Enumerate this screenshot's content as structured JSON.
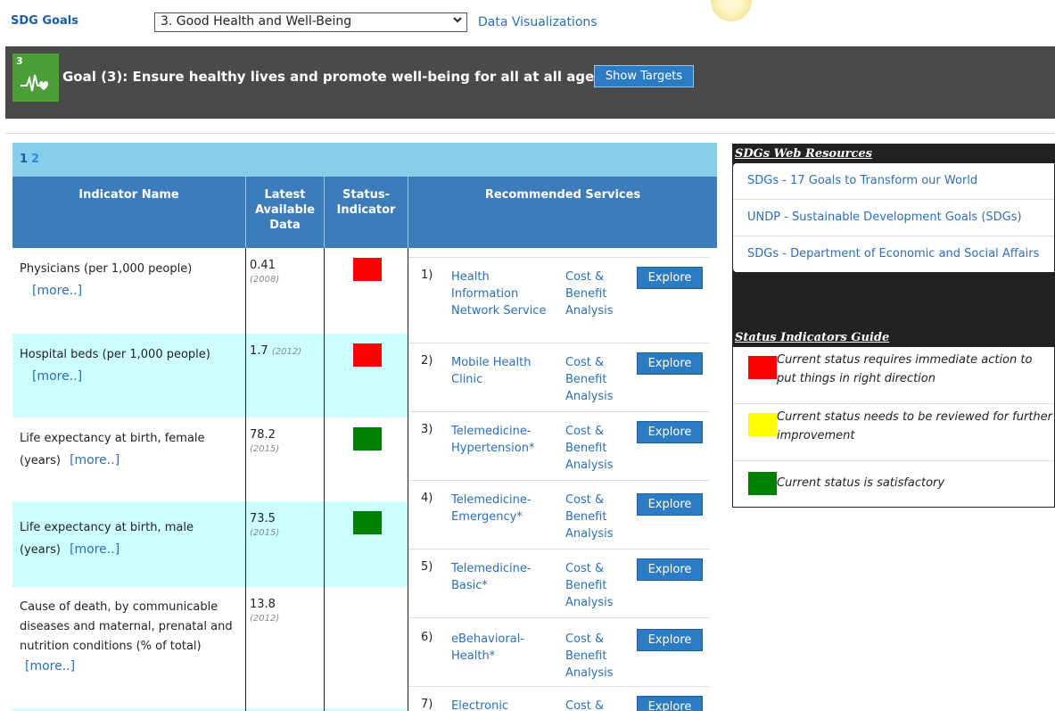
{
  "header": {
    "sdg_label": "SDG Goals",
    "selected_goal": "3. Good Health and Well-Being",
    "data_vis_link": "Data Visualizations"
  },
  "banner": {
    "icon_number": "3",
    "title": "Goal (3): Ensure healthy lives and promote well-being for all at all ages",
    "show_targets": "Show Targets",
    "icon_color": "#4c9f38"
  },
  "pager": [
    "1",
    "2"
  ],
  "table_headers": {
    "name": "Indicator Name",
    "latest": "Latest Available Data",
    "status": "Status-Indicator",
    "services": "Recommended Services"
  },
  "indicators": [
    {
      "name": "Physicians (per 1,000 people)",
      "value": "0.41",
      "year": "(2008)",
      "status": "red",
      "more": "[more..]"
    },
    {
      "name": "Hospital beds (per 1,000 people)",
      "value": "1.7",
      "year": "(2012)",
      "status": "red",
      "more": "[more..]"
    },
    {
      "name": "Life expectancy at birth, female (years)",
      "value": "78.2",
      "year": "(2015)",
      "status": "green",
      "more": "[more..]"
    },
    {
      "name": "Life expectancy at birth, male (years)",
      "value": "73.5",
      "year": "(2015)",
      "status": "green",
      "more": "[more..]"
    },
    {
      "name": "Cause of death, by communicable diseases and maternal, prenatal and nutrition conditions (% of total)",
      "value": "13.8",
      "year": "(2012)",
      "status": "none",
      "more": "[more..]"
    }
  ],
  "services": [
    {
      "n": "1)",
      "name": "Health Information Network Service",
      "cba": "Cost & Benefit Analysis",
      "explore": "Explore"
    },
    {
      "n": "2)",
      "name": "Mobile Health Clinic",
      "cba": "Cost & Benefit Analysis",
      "explore": "Explore"
    },
    {
      "n": "3)",
      "name": "Telemedicine-Hypertension*",
      "cba": "Cost & Benefit Analysis",
      "explore": "Explore"
    },
    {
      "n": "4)",
      "name": "Telemedicine-Emergency*",
      "cba": "Cost & Benefit Analysis",
      "explore": "Explore"
    },
    {
      "n": "5)",
      "name": "Telemedicine-Basic*",
      "cba": "Cost & Benefit Analysis",
      "explore": "Explore"
    },
    {
      "n": "6)",
      "name": "eBehavioral-Health*",
      "cba": "Cost & Benefit Analysis",
      "explore": "Explore"
    },
    {
      "n": "7)",
      "name": "Electronic",
      "cba": "Cost &",
      "explore": "Explore"
    }
  ],
  "web_resources": {
    "title": "SDGs Web Resources",
    "items": [
      "SDGs - 17 Goals to Transform our World",
      "UNDP - Sustainable Development Goals (SDGs)",
      "SDGs - Department of Economic and Social Affairs"
    ]
  },
  "status_guide": {
    "title": "Status Indicators Guide",
    "items": [
      {
        "color": "#ff0000",
        "text": "Current status requires immediate action to put things in right direction"
      },
      {
        "color": "#ffff00",
        "text": "Current status needs to be reviewed for further improvement"
      },
      {
        "color": "#008000",
        "text": "Current status is satisfactory"
      }
    ]
  },
  "colors": {
    "red": "#ff0000",
    "yellow": "#ffff00",
    "green": "#008000",
    "header_blue": "#3d7cba",
    "pager_blue": "#87ceeb",
    "alt_row": "#ccffff"
  }
}
